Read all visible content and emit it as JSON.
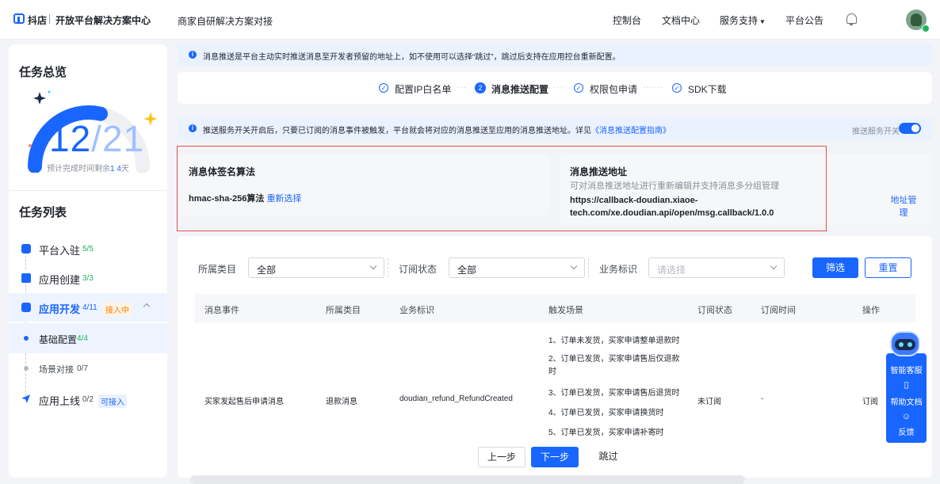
{
  "topbar": {
    "brand": "抖店",
    "brand_sub": "开放平台解决方案中心",
    "title": "商家自研解决方案对接",
    "nav": [
      "控制台",
      "文档中心",
      "服务支持",
      "平台公告"
    ]
  },
  "sidebar": {
    "overview_title": "任务总览",
    "progress_done": "12",
    "progress_total": "21",
    "progress_fraction": 0.571,
    "remaining_prefix": "预计完成时间剩余",
    "remaining_value": "1 4",
    "remaining_suffix": "天",
    "list_title": "任务列表",
    "tasks": [
      {
        "label": "平台入驻",
        "count": "5/5"
      },
      {
        "label": "应用创建",
        "count": "3/3"
      },
      {
        "label": "应用开发",
        "count": "4/11",
        "tag": "接入中"
      },
      {
        "label": "基础配置",
        "count": "4/4"
      },
      {
        "label": "场景对接",
        "count": "0/7"
      },
      {
        "label": "应用上线",
        "count": "0/2",
        "tag": "可接入"
      }
    ]
  },
  "notice": "消息推送是平台主动实时推送消息至开发者预留的地址上，如不使用可以选择“跳过”，跳过后支持在应用控台重新配置。",
  "steps": [
    {
      "label": "配置IP白名单",
      "state": "done"
    },
    {
      "label": "消息推送配置",
      "state": "current",
      "num": "2"
    },
    {
      "label": "权限包申请",
      "state": "done"
    },
    {
      "label": "SDK下载",
      "state": "done"
    }
  ],
  "push_notice": {
    "text": "推送服务开关开启后，只要已订阅的消息事件被触发，平台就会将对应的消息推送至应用的消息推送地址。详见",
    "link": "《消息推送配置指南》",
    "toggle_label": "推送服务开关",
    "toggle_on": true
  },
  "signature": {
    "title": "消息体签名算法",
    "value": "hmac-sha-256算法",
    "action": "重新选择"
  },
  "push_address": {
    "title": "消息推送地址",
    "subtitle": "可对消息推送地址进行重新编辑并支持消息多分组管理",
    "url_line1": "https://callback-doudian.xiaoe-",
    "url_line2": "tech.com/xe.doudian.api/open/msg.callback/1.0.0",
    "manage": "地址管理"
  },
  "filters": {
    "category_label": "所属类目",
    "category_value": "全部",
    "status_label": "订阅状态",
    "status_value": "全部",
    "biz_label": "业务标识",
    "biz_placeholder": "请选择",
    "filter_btn": "筛选",
    "reset_btn": "重置"
  },
  "table": {
    "headers": [
      "消息事件",
      "所属类目",
      "业务标识",
      "触发场景",
      "订阅状态",
      "订阅时间",
      "操作"
    ],
    "row": {
      "event": "买家发起售后申请消息",
      "category": "退款消息",
      "biz": "doudian_refund_RefundCreated",
      "scenes": [
        "1、订单未发货，买家申请整单退款时",
        "2、订单已发货，买家申请售后仅退款",
        "时",
        "3、订单已发货，买家申请售后退货时",
        "4、订单已发货，买家申请换货时",
        "5、订单已发货，买家申请补寄时"
      ],
      "status": "未订阅",
      "time": "-",
      "action": "订阅"
    }
  },
  "footer": {
    "prev": "上一步",
    "next": "下一步",
    "skip": "跳过"
  },
  "float_bar": {
    "service": "智能客服",
    "docs": "帮助文档",
    "feedback": "反馈"
  }
}
